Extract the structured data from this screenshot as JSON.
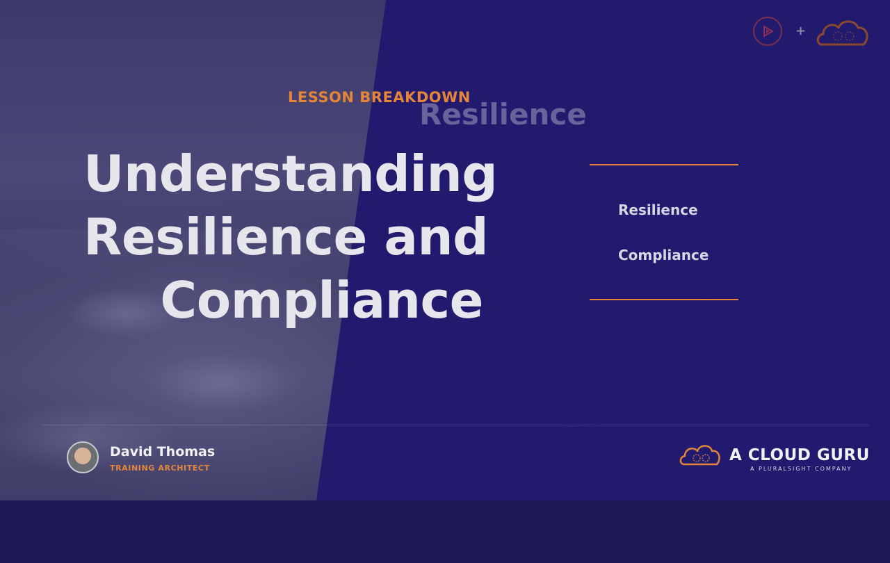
{
  "slide": {
    "eyebrow": "LESSON BREAKDOWN",
    "ghost_title": "Resilience",
    "title_lines": [
      "Understanding",
      "Resilience and",
      "Compliance"
    ],
    "topics": [
      "Resilience",
      "Compliance"
    ]
  },
  "presenter": {
    "name": "David Thomas",
    "role": "TRAINING ARCHITECT"
  },
  "brand": {
    "name": "A CLOUD GURU",
    "tagline": "A PLURALSIGHT COMPANY"
  },
  "header": {
    "plus_symbol": "+"
  },
  "colors": {
    "accent": "#e4853a",
    "panel": "#221a6e"
  },
  "icons": [
    "pluralsight-play-icon",
    "cloud-guru-icon"
  ]
}
